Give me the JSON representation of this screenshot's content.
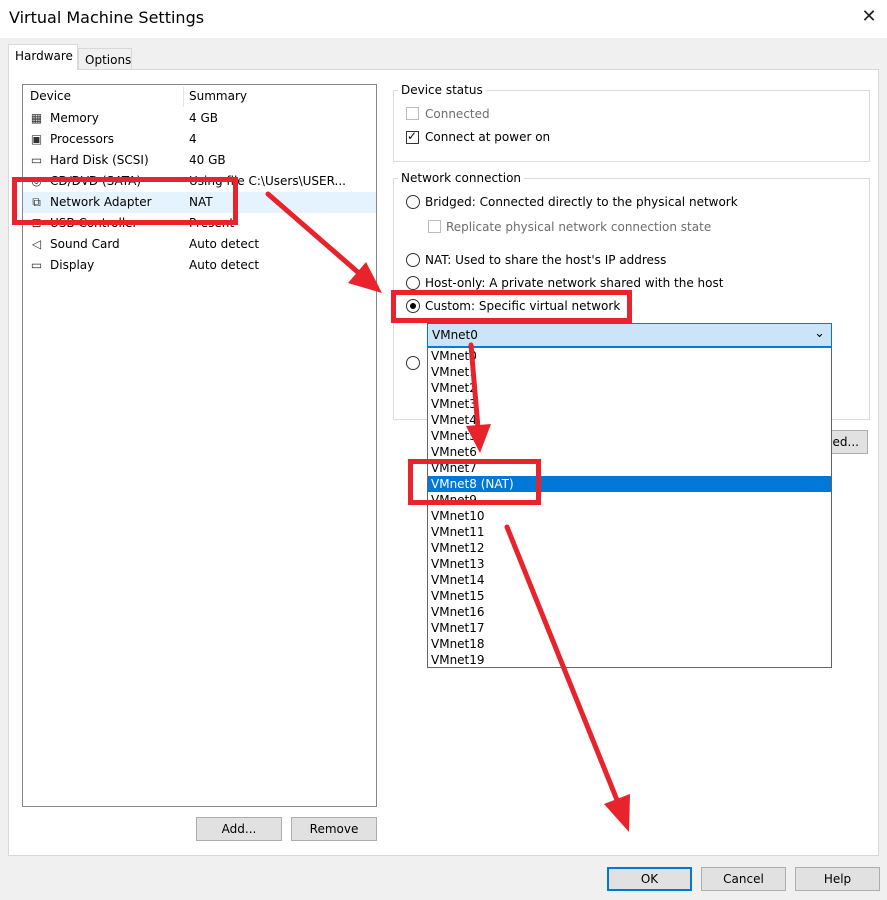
{
  "window": {
    "title": "Virtual Machine Settings",
    "close_glyph": "✕"
  },
  "tabs": [
    {
      "label": "Hardware"
    },
    {
      "label": "Options"
    }
  ],
  "device_list": {
    "headers": {
      "device": "Device",
      "summary": "Summary"
    },
    "rows": [
      {
        "name": "Memory",
        "summary": "4 GB",
        "icon": "memory-icon"
      },
      {
        "name": "Processors",
        "summary": "4",
        "icon": "processor-icon"
      },
      {
        "name": "Hard Disk (SCSI)",
        "summary": "40 GB",
        "icon": "hard-disk-icon"
      },
      {
        "name": "CD/DVD (SATA)",
        "summary": "Using file C:\\Users\\USER...",
        "icon": "cd-dvd-icon"
      },
      {
        "name": "Network Adapter",
        "summary": "NAT",
        "icon": "network-adapter-icon"
      },
      {
        "name": "USB Controller",
        "summary": "Present",
        "icon": "usb-icon"
      },
      {
        "name": "Sound Card",
        "summary": "Auto detect",
        "icon": "speaker-icon"
      },
      {
        "name": "Display",
        "summary": "Auto detect",
        "icon": "monitor-icon"
      }
    ]
  },
  "buttons": {
    "add": "Add...",
    "remove": "Remove",
    "ok": "OK",
    "cancel": "Cancel",
    "help": "Help",
    "advanced_partial": "ed..."
  },
  "device_status": {
    "label": "Device status",
    "connected": {
      "label": "Connected",
      "checked": false,
      "enabled": false
    },
    "connect_at_power_on": {
      "label": "Connect at power on",
      "checked": true
    }
  },
  "network_connection": {
    "label": "Network connection",
    "bridged": "Bridged: Connected directly to the physical network",
    "replicate": "Replicate physical network connection state",
    "nat": "NAT: Used to share the host's IP address",
    "host_only": "Host-only: A private network shared with the host",
    "custom": "Custom: Specific virtual network",
    "selected": "custom"
  },
  "combo": {
    "value": "VMnet0",
    "chevron": "⌄"
  },
  "dropdown": {
    "options": [
      "VMnet0",
      "VMnet1",
      "VMnet2",
      "VMnet3",
      "VMnet4",
      "VMnet5",
      "VMnet6",
      "VMnet7",
      "VMnet8 (NAT)",
      "VMnet9",
      "VMnet10",
      "VMnet11",
      "VMnet12",
      "VMnet13",
      "VMnet14",
      "VMnet15",
      "VMnet16",
      "VMnet17",
      "VMnet18",
      "VMnet19"
    ],
    "highlighted": "VMnet8 (NAT)"
  },
  "colors": {
    "accent": "#0078d7",
    "annotation": "#e8232b",
    "selection_row": "#e5f3ff"
  }
}
